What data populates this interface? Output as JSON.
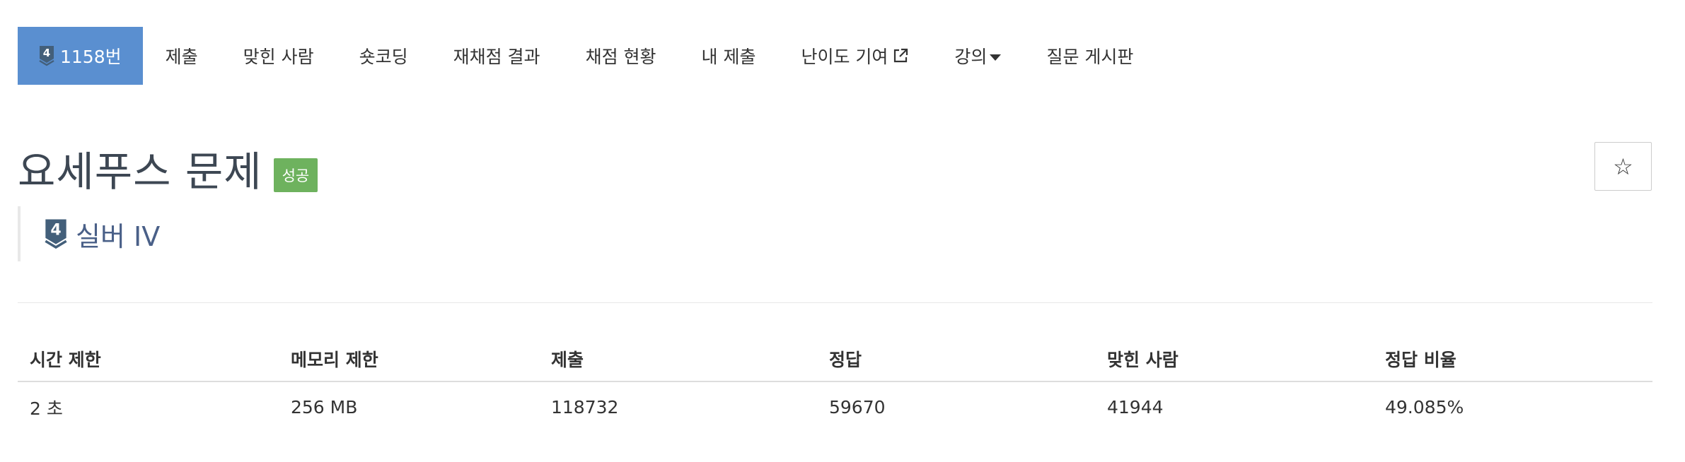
{
  "nav": {
    "problem_label": "1158번",
    "tier_number": "4",
    "items": [
      {
        "label": "제출"
      },
      {
        "label": "맞힌 사람"
      },
      {
        "label": "숏코딩"
      },
      {
        "label": "재채점 결과"
      },
      {
        "label": "채점 현황"
      },
      {
        "label": "내 제출"
      },
      {
        "label": "난이도 기여",
        "icon": "external-link-icon"
      },
      {
        "label": "강의",
        "icon": "caret-down-icon"
      },
      {
        "label": "질문 게시판"
      }
    ]
  },
  "problem": {
    "title": "요세푸스 문제",
    "result_badge": "성공",
    "star_icon": "☆",
    "tier_number": "4",
    "tier_name": "실버 IV"
  },
  "colors": {
    "nav_active": "#5a8fd0",
    "success_badge": "#6eb25e",
    "tier_silver": "#435f7a"
  },
  "info": {
    "headers": [
      "시간 제한",
      "메모리 제한",
      "제출",
      "정답",
      "맞힌 사람",
      "정답 비율"
    ],
    "row": [
      "2 초",
      "256 MB",
      "118732",
      "59670",
      "41944",
      "49.085%"
    ]
  }
}
